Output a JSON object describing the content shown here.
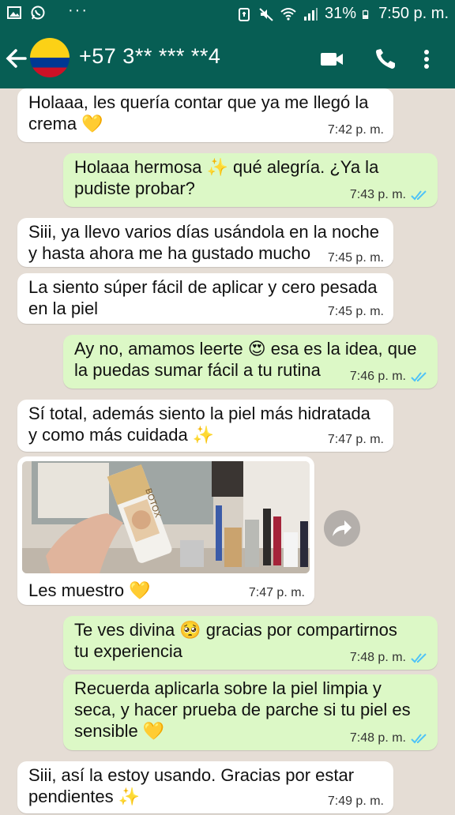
{
  "status_bar": {
    "battery": "31%",
    "time": "7:50 p. m.",
    "menu": "···"
  },
  "header": {
    "contact": "+57 3** *** **4",
    "icons": [
      "back-arrow-icon",
      "colombia-flag-avatar",
      "video-call-icon",
      "phone-icon",
      "more-vert-icon"
    ]
  },
  "colors": {
    "header": "#075e54",
    "incoming": "#ffffff",
    "outgoing": "#dcf8c6",
    "read_ticks": "#4fc3f7"
  },
  "messages": [
    {
      "dir": "in",
      "lines": [
        "Holaaa, les quería contar que ya me llegó la",
        "crema 💛"
      ],
      "time": "7:42 p. m."
    },
    {
      "dir": "out",
      "lines": [
        "Holaaa hermosa ✨ qué alegría. ¿Ya la",
        "pudiste probar?"
      ],
      "time": "7:43 p. m."
    },
    {
      "dir": "in",
      "lines": [
        "Siii, ya llevo varios días usándola en la noche",
        "y hasta ahora me ha gustado mucho"
      ],
      "time": "7:45 p. m."
    },
    {
      "dir": "in",
      "lines": [
        "La siento súper fácil de aplicar y cero pesada",
        "en la piel"
      ],
      "time": "7:45 p. m."
    },
    {
      "dir": "out",
      "lines": [
        "Ay no, amamos leerte 😍 esa es la idea, que",
        "la puedas sumar fácil a tu rutina"
      ],
      "time": "7:46 p. m."
    },
    {
      "dir": "in",
      "lines": [
        "Sí total, además siento la piel más hidratada",
        "y como más cuidada ✨"
      ],
      "time": "7:47 p. m."
    },
    {
      "dir": "in",
      "photo": true,
      "lines": [
        "Les muestro 💛"
      ],
      "time": "7:47 p. m.",
      "product_text": "BOTOX"
    },
    {
      "dir": "out",
      "lines": [
        "Te ves divina 🥺 gracias por compartirnos",
        "tu experiencia"
      ],
      "time": "7:48 p. m."
    },
    {
      "dir": "out",
      "lines": [
        "Recuerda aplicarla sobre la piel limpia y",
        "seca, y hacer prueba de parche si tu piel es",
        "sensible 💛"
      ],
      "time": "7:48 p. m."
    },
    {
      "dir": "in",
      "lines": [
        "Siii, así la estoy usando. Gracias por estar",
        "pendientes ✨"
      ],
      "time": "7:49 p. m."
    }
  ]
}
